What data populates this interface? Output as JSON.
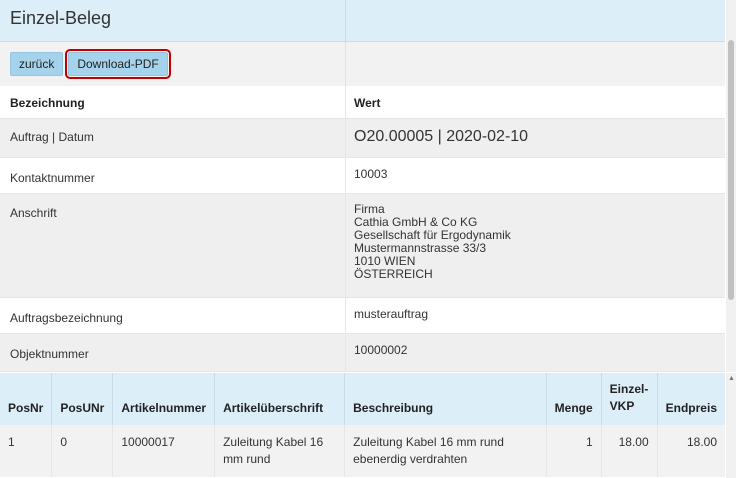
{
  "header": {
    "title": "Einzel-Beleg"
  },
  "toolbar": {
    "back_label": "zurück",
    "download_label": "Download-PDF"
  },
  "details": {
    "col_label": "Bezeichnung",
    "col_value": "Wert",
    "rows": [
      {
        "label": "Auftrag | Datum",
        "value": "O20.00005 | 2020-02-10"
      },
      {
        "label": "Kontaktnummer",
        "value": "10003"
      },
      {
        "label": "Anschrift",
        "lines": [
          "Firma",
          "Cathia GmbH & Co KG",
          "Gesellschaft für Ergodynamik",
          "Mustermannstrasse 33/3",
          "1010 WIEN",
          "ÖSTERREICH"
        ]
      },
      {
        "label": "Auftragsbezeichnung",
        "value": "musterauftrag"
      },
      {
        "label": "Objektnummer",
        "value": "10000002"
      }
    ]
  },
  "positions": {
    "headers": {
      "posnr": "PosNr",
      "posunr": "PosUNr",
      "artikelnummer": "Artikelnummer",
      "artikelueberschrift": "Artikelüberschrift",
      "beschreibung": "Beschreibung",
      "menge": "Menge",
      "einzelvkp_1": "Einzel-",
      "einzelvkp_2": "VKP",
      "endpreis": "Endpreis"
    },
    "rows": [
      {
        "posnr": "1",
        "posunr": "0",
        "artikelnummer": "10000017",
        "artikelueberschrift": "Zuleitung Kabel 16 mm rund",
        "beschreibung": "Zuleitung Kabel 16 mm rund ebenerdig verdrahten",
        "menge": "1",
        "einzelvkp": "18.00",
        "endpreis": "18.00"
      }
    ]
  }
}
